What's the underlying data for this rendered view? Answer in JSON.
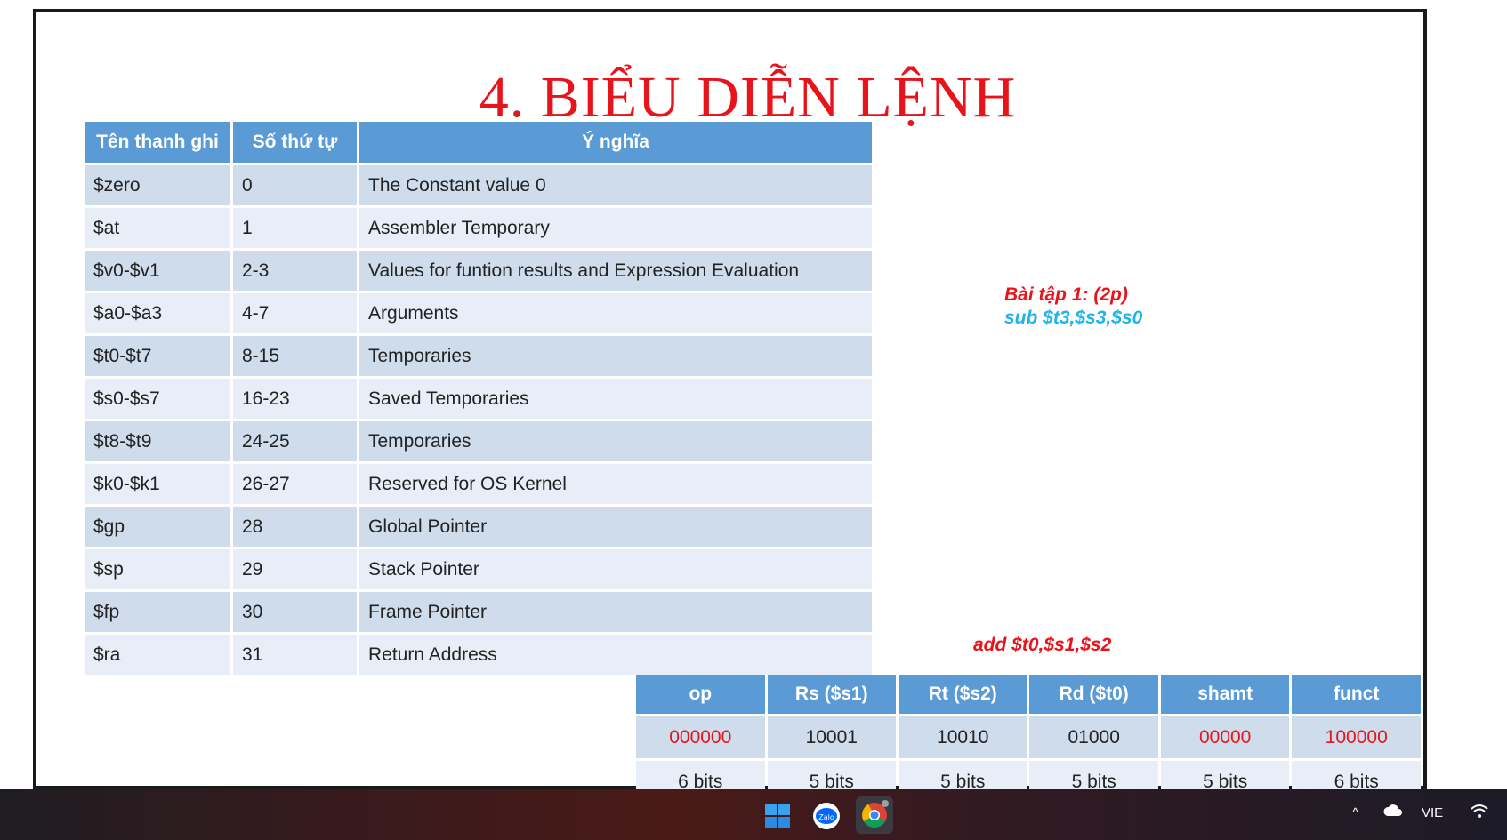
{
  "slide": {
    "title": "4. BIỂU DIỄN LỆNH",
    "register_table": {
      "headers": [
        "Tên thanh ghi",
        "Số thứ tự",
        "Ý nghĩa"
      ],
      "rows": [
        [
          "$zero",
          "0",
          "The Constant value 0"
        ],
        [
          "$at",
          "1",
          "Assembler Temporary"
        ],
        [
          "$v0-$v1",
          "2-3",
          "Values for funtion results and Expression Evaluation"
        ],
        [
          "$a0-$a3",
          "4-7",
          "Arguments"
        ],
        [
          "$t0-$t7",
          "8-15",
          "Temporaries"
        ],
        [
          "$s0-$s7",
          "16-23",
          "Saved Temporaries"
        ],
        [
          "$t8-$t9",
          "24-25",
          "Temporaries"
        ],
        [
          "$k0-$k1",
          "26-27",
          "Reserved for OS Kernel"
        ],
        [
          "$gp",
          "28",
          "Global Pointer"
        ],
        [
          "$sp",
          "29",
          "Stack Pointer"
        ],
        [
          "$fp",
          "30",
          "Frame Pointer"
        ],
        [
          "$ra",
          "31",
          "Return Address"
        ]
      ]
    },
    "exercise": {
      "label": "Bài tập 1: (2p)",
      "instruction": "sub $t3,$s3,$s0"
    },
    "example_instruction": "add $t0,$s1,$s2",
    "format_table": {
      "headers": [
        "op",
        "Rs ($s1)",
        "Rt ($s2)",
        "Rd ($t0)",
        "shamt",
        "funct"
      ],
      "bits": [
        "000000",
        "10001",
        "10010",
        "01000",
        "00000",
        "100000"
      ],
      "sizes": [
        "6 bits",
        "5 bits",
        "5 bits",
        "5 bits",
        "5 bits",
        "6 bits"
      ]
    },
    "colors": {
      "title": "#e8141b",
      "header": "#5b9bd5",
      "accent_blue": "#1fb4ea"
    }
  },
  "taskbar": {
    "icons": [
      "windows-start-icon",
      "zalo-icon",
      "chrome-icon"
    ],
    "zalo_label": "Zalo",
    "tray": {
      "language": "VIE"
    }
  }
}
